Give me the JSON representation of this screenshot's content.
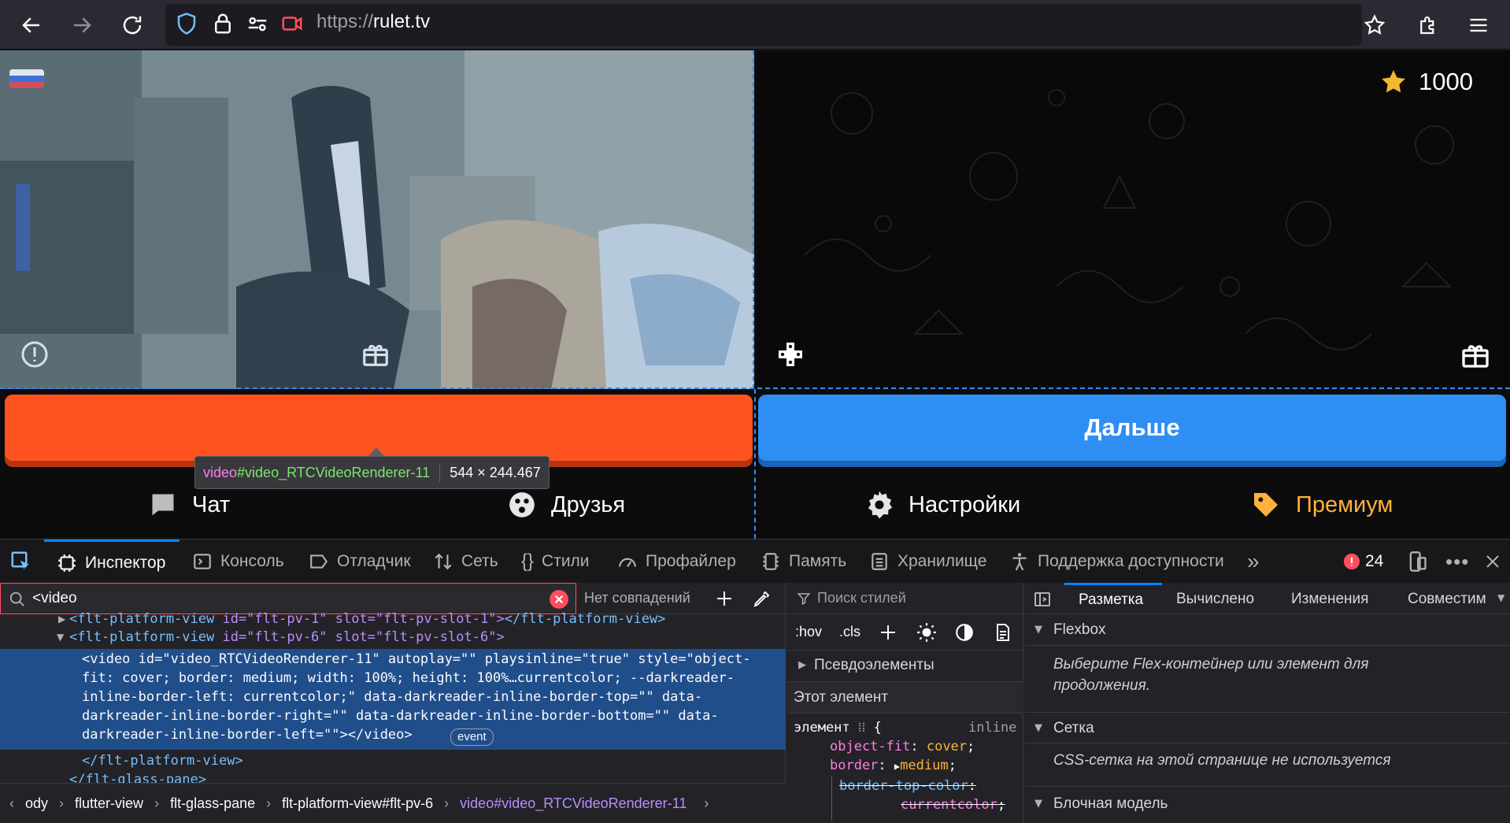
{
  "browser": {
    "url_scheme": "https://",
    "url_host": "rulet.tv"
  },
  "page": {
    "stars": "1000",
    "next_button": "Дальше",
    "stop_button": "",
    "nav": {
      "chat": "Чат",
      "friends": "Друзья",
      "settings": "Настройки",
      "premium": "Премиум"
    },
    "tooltip": {
      "tag": "video",
      "id": "#video_RTCVideoRenderer-11",
      "size": "544 × 244.467"
    }
  },
  "devtools": {
    "tabs": {
      "inspector": "Инспектор",
      "console": "Консоль",
      "debugger": "Отладчик",
      "network": "Сеть",
      "styles": "Стили",
      "profiler": "Профайлер",
      "memory": "Память",
      "storage": "Хранилище",
      "a11y": "Поддержка доступности"
    },
    "error_count": "24",
    "search": {
      "value": "<video",
      "result": "Нет совпадений"
    },
    "markup": {
      "line1_tag": "<flt-platform-view",
      "line1_attrs": " id=\"flt-pv-1\" slot=\"flt-pv-slot-1\">",
      "line1_end": "</flt-platform-view>",
      "line2_tag": "<flt-platform-view",
      "line2_attrs": " id=\"flt-pv-6\" slot=\"flt-pv-slot-6\">",
      "sel1": "<video id=\"video_RTCVideoRenderer-11\" autoplay=\"\" playsinline=\"true\" style=\"object-",
      "sel2": "fit: cover; border: medium; width: 100%; height: 100%…currentcolor; --darkreader-",
      "sel3": "inline-border-left: currentcolor;\" data-darkreader-inline-border-top=\"\" data-",
      "sel4": "darkreader-inline-border-right=\"\" data-darkreader-inline-border-bottom=\"\" data-",
      "sel5": "darkreader-inline-border-left=\"\"></video>",
      "event_badge": "event",
      "close1": "</flt-platform-view>",
      "close2": "</flt-glass-pane>"
    },
    "breadcrumbs": [
      "ody",
      "flutter-view",
      "flt-glass-pane",
      "flt-platform-view#flt-pv-6",
      "video#video_RTCVideoRenderer-11"
    ],
    "rules": {
      "filter_placeholder": "Поиск стилей",
      "hov": ":hov",
      "cls": ".cls",
      "pseudo": "Псевдоэлементы",
      "this_element": "Этот элемент",
      "element_selector": "элемент",
      "inline": "inline",
      "prop1": "object-fit",
      "val1": "cover",
      "prop2": "border",
      "val2": "medium",
      "prop3": "border-top-color",
      "val3": "currentcolor"
    },
    "layout": {
      "tabs": [
        "Разметка",
        "Вычислено",
        "Изменения",
        "Совместим"
      ],
      "flexbox": "Flexbox",
      "flexbox_hint": "Выберите Flex-контейнер или элемент для продолжения.",
      "grid": "Сетка",
      "grid_hint": "CSS-сетка на этой странице не используется",
      "box_model": "Блочная модель"
    }
  },
  "colors": {
    "accent": "#0a84ff",
    "stop": "#ff531f",
    "next": "#2f8ef3",
    "premium": "#ffb13b"
  }
}
